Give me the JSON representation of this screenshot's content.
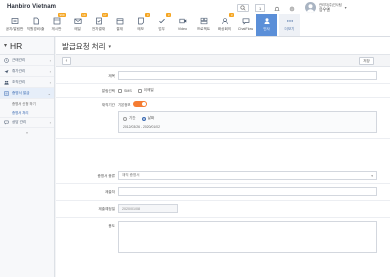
{
  "brand": "Hanbiro Vietnam",
  "apps": [
    {
      "label": "공지/알림판",
      "badge": ""
    },
    {
      "label": "직원경비/출",
      "badge": ""
    },
    {
      "label": "게시판",
      "badge": "999"
    },
    {
      "label": "메일",
      "badge": "19"
    },
    {
      "label": "전자결재",
      "badge": "17"
    },
    {
      "label": "결재",
      "badge": ""
    },
    {
      "label": "메모",
      "badge": "3"
    },
    {
      "label": "업무",
      "badge": "3"
    },
    {
      "label": "Video",
      "badge": ""
    },
    {
      "label": "프로젝트",
      "badge": ""
    },
    {
      "label": "화상회의",
      "badge": "3"
    },
    {
      "label": "ChatFlow",
      "badge": ""
    },
    {
      "label": "인사",
      "badge": ""
    }
  ],
  "more_label": "더보기",
  "top": {
    "count": "1"
  },
  "user": {
    "role": "관리자(주)인사팀",
    "name": "응우옌"
  },
  "sidebar": {
    "title": "HR",
    "items": [
      {
        "label": "근태관리"
      },
      {
        "label": "휴가관리"
      },
      {
        "label": "조직관리"
      },
      {
        "label": "증명서 발급"
      },
      {
        "label": "상담 관리"
      }
    ],
    "subitems": [
      {
        "label": "증명서 신청 하기"
      },
      {
        "label": "증명서 처리"
      }
    ]
  },
  "page": {
    "title": "발급요청 처리",
    "save_label": "저장"
  },
  "form": {
    "subject_label": "제목",
    "notify_label": "알림선택",
    "notify_options": [
      "SMS",
      "이메일"
    ],
    "period_label": "재직기간",
    "default_period_label": "기본정보",
    "period_options": [
      "기간",
      "날짜"
    ],
    "period_dates": "2012/03/26 - 2020/01/02",
    "type_label": "증명서 종류",
    "type_value": "재직 증명서",
    "submit_to_label": "제출처",
    "date_label": "제출예정일",
    "date_value": "2020/01/08",
    "purpose_label": "용도"
  }
}
